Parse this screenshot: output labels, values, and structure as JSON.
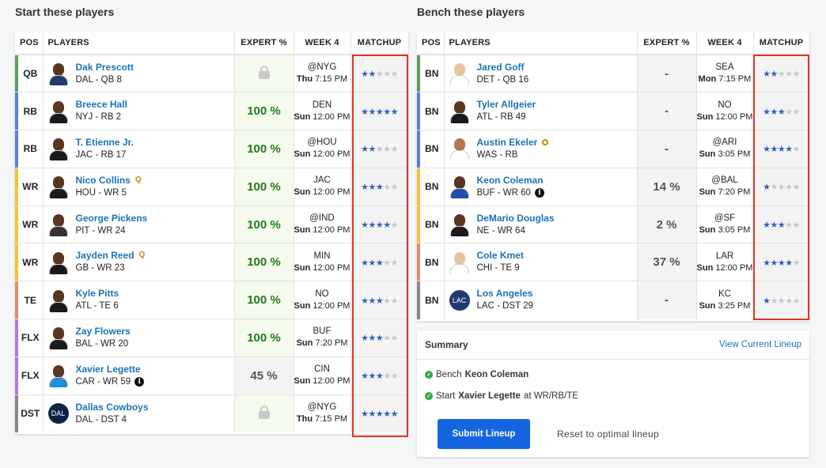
{
  "start_section": {
    "title": "Start these players",
    "headers": {
      "pos": "POS",
      "players": "PLAYERS",
      "expert": "EXPERT %",
      "week": "WEEK 4",
      "matchup": "MATCHUP"
    },
    "rows": [
      {
        "pos": "QB",
        "bar": "#5e9e5e",
        "name": "Dak Prescott",
        "sub": "DAL - QB 8",
        "expert": "",
        "locked": true,
        "opp": "@NYG",
        "day": "Thu",
        "time": "7:15 PM",
        "stars": 2,
        "avatar": "skin-dark",
        "jersey": "#1d3c6d"
      },
      {
        "pos": "RB",
        "bar": "#5c7de0",
        "name": "Breece Hall",
        "sub": "NYJ - RB 2",
        "expert": "100 %",
        "locked": false,
        "opp": "DEN",
        "day": "Sun",
        "time": "12:00 PM",
        "stars": 5,
        "avatar": "skin-dark",
        "jersey": "#1a1a1a"
      },
      {
        "pos": "RB",
        "bar": "#5c7de0",
        "name": "T. Etienne Jr.",
        "sub": "JAC - RB 17",
        "expert": "100 %",
        "locked": false,
        "opp": "@HOU",
        "day": "Sun",
        "time": "12:00 PM",
        "stars": 2,
        "avatar": "skin-dark",
        "jersey": "#1a1a1a"
      },
      {
        "pos": "WR",
        "bar": "#f1c438",
        "name": "Nico Collins",
        "sub": "HOU - WR 5",
        "expert": "100 %",
        "locked": false,
        "opp": "JAC",
        "day": "Sun",
        "time": "12:00 PM",
        "stars": 3,
        "avatar": "skin-dark",
        "jersey": "#1a1a1a",
        "badge": "Q"
      },
      {
        "pos": "WR",
        "bar": "#f1c438",
        "name": "George Pickens",
        "sub": "PIT - WR 24",
        "expert": "100 %",
        "locked": false,
        "opp": "@IND",
        "day": "Sun",
        "time": "12:00 PM",
        "stars": 4,
        "avatar": "skin-dark",
        "jersey": "#333333"
      },
      {
        "pos": "WR",
        "bar": "#f1c438",
        "name": "Jayden Reed",
        "sub": "GB - WR 23",
        "expert": "100 %",
        "locked": false,
        "opp": "MIN",
        "day": "Sun",
        "time": "12:00 PM",
        "stars": 3,
        "avatar": "skin-dark",
        "jersey": "#1a1a1a",
        "badge": "Q"
      },
      {
        "pos": "TE",
        "bar": "#e08c6e",
        "name": "Kyle Pitts",
        "sub": "ATL - TE 6",
        "expert": "100 %",
        "locked": false,
        "opp": "NO",
        "day": "Sun",
        "time": "12:00 PM",
        "stars": 3,
        "avatar": "skin-dark",
        "jersey": "#1a1a1a"
      },
      {
        "pos": "FLX",
        "bar": "#b57ad6",
        "name": "Zay Flowers",
        "sub": "BAL - WR 20",
        "expert": "100 %",
        "locked": false,
        "opp": "BUF",
        "day": "Sun",
        "time": "7:20 PM",
        "stars": 3,
        "avatar": "skin-dark",
        "jersey": "#1a1a1a"
      },
      {
        "pos": "FLX",
        "bar": "#b57ad6",
        "name": "Xavier Legette",
        "sub": "CAR - WR 59",
        "expert": "45 %",
        "locked": false,
        "gray": true,
        "opp": "CIN",
        "day": "Sun",
        "time": "12:00 PM",
        "stars": 3,
        "avatar": "skin-dark",
        "jersey": "#1d8fd4",
        "info": true
      },
      {
        "pos": "DST",
        "bar": "#888888",
        "name": "Dallas Cowboys",
        "sub": "DAL - DST 4",
        "expert": "",
        "locked": true,
        "opp": "@NYG",
        "day": "Thu",
        "time": "7:15 PM",
        "stars": 5,
        "logo": "DAL",
        "logo_color": "#0b2545"
      }
    ]
  },
  "bench_section": {
    "title": "Bench these players",
    "headers": {
      "pos": "POS",
      "players": "PLAYERS",
      "expert": "EXPERT %",
      "week": "WEEK 4",
      "matchup": "MATCHUP"
    },
    "rows": [
      {
        "pos": "BN",
        "bar": "#5e9e5e",
        "name": "Jared Goff",
        "sub": "DET - QB 16",
        "expert": "-",
        "opp": "SEA",
        "day": "Mon",
        "time": "7:15 PM",
        "stars": 2,
        "avatar": "skin-light",
        "jersey": "#ffffff"
      },
      {
        "pos": "BN",
        "bar": "#5c7de0",
        "name": "Tyler Allgeier",
        "sub": "ATL - RB 49",
        "expert": "-",
        "opp": "NO",
        "day": "Sun",
        "time": "12:00 PM",
        "stars": 3,
        "avatar": "skin-dark",
        "jersey": "#1a1a1a"
      },
      {
        "pos": "BN",
        "bar": "#5c7de0",
        "name": "Austin Ekeler",
        "sub": "WAS - RB",
        "expert": "-",
        "opp": "@ARI",
        "day": "Sun",
        "time": "3:05 PM",
        "stars": 4,
        "avatar": "skin-mid",
        "jersey": "#ffffff",
        "obadge": true
      },
      {
        "pos": "BN",
        "bar": "#f1c438",
        "name": "Keon Coleman",
        "sub": "BUF - WR 60",
        "expert": "14 %",
        "opp": "@BAL",
        "day": "Sun",
        "time": "7:20 PM",
        "stars": 1,
        "avatar": "skin-dark",
        "jersey": "#1d4fb0",
        "info": true
      },
      {
        "pos": "BN",
        "bar": "#f1c438",
        "name": "DeMario Douglas",
        "sub": "NE - WR 64",
        "expert": "2 %",
        "opp": "@SF",
        "day": "Sun",
        "time": "3:05 PM",
        "stars": 3,
        "avatar": "skin-dark",
        "jersey": "#1a1a1a"
      },
      {
        "pos": "BN",
        "bar": "#e08c6e",
        "name": "Cole Kmet",
        "sub": "CHI - TE 9",
        "expert": "37 %",
        "opp": "LAR",
        "day": "Sun",
        "time": "12:00 PM",
        "stars": 4,
        "avatar": "skin-light",
        "jersey": "#ffffff"
      },
      {
        "pos": "BN",
        "bar": "#888888",
        "name": "Los Angeles",
        "sub": "LAC - DST 29",
        "expert": "-",
        "opp": "KC",
        "day": "Sun",
        "time": "3:25 PM",
        "stars": 1,
        "logo": "LAC",
        "logo_color": "#1f3b6e"
      }
    ]
  },
  "summary": {
    "title": "Summary",
    "view_link": "View Current Lineup",
    "line1_prefix": "Bench",
    "line1_name": "Keon Coleman",
    "line2_prefix": "Start",
    "line2_name": "Xavier Legette",
    "line2_suffix": "at WR/RB/TE",
    "submit_label": "Submit Lineup",
    "reset_label": "Reset to optimal lineup"
  },
  "colors": {
    "accent": "#1565e0",
    "link": "#1a73b8",
    "highlight": "#e53222",
    "star_on": "#2f5ec4",
    "expert_green": "#1f7a1f"
  }
}
